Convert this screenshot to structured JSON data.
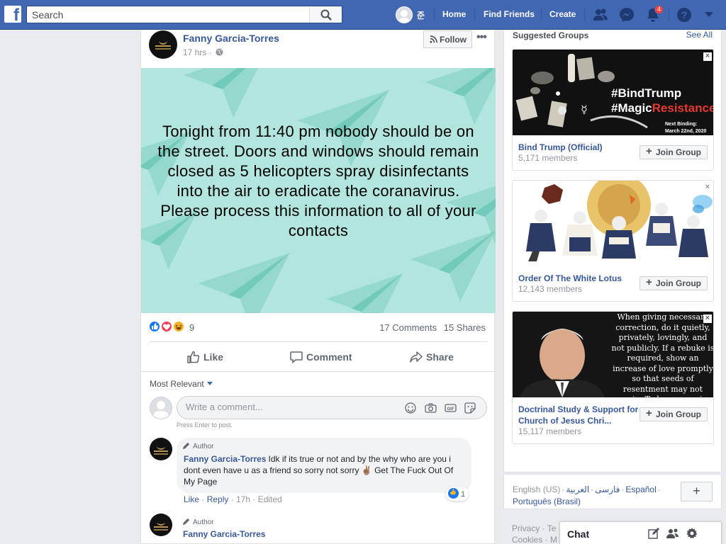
{
  "header": {
    "search_placeholder": "Search",
    "user_name": "준",
    "nav": [
      "Home",
      "Find Friends",
      "Create"
    ],
    "notifications_count": "4"
  },
  "post": {
    "author": "Fanny Garcia-Torres",
    "time": "17 hrs ·",
    "follow_label": "Follow",
    "more": "•••",
    "text": "Tonight from 11:40 pm nobody should be on the street. Doors and windows should remain closed as 5 helicopters spray disinfectants into the air to eradicate the coranavirus. Please process this information to all of your contacts",
    "background_color": "#b1e5dd",
    "reaction_count": "9",
    "comments_count": "17 Comments",
    "shares_count": "15 Shares",
    "actions": {
      "like": "Like",
      "comment": "Comment",
      "share": "Share"
    },
    "sort_label": "Most Relevant",
    "comment_placeholder": "Write a comment...",
    "press_enter": "Press Enter to post."
  },
  "comments": [
    {
      "tag": "Author",
      "name": "Fanny Garcia-Torres",
      "text": "Idk if its true or not and by the why who are you i dont even have u as a friend so sorry not sorry ✌🏽 Get The Fuck Out Of My Page",
      "likes": "1",
      "like_label": "Like",
      "reply_label": "Reply",
      "meta": "· 17h · Edited"
    },
    {
      "tag": "Author",
      "name": "Fanny Garcia-Torres"
    }
  ],
  "sidebar": {
    "title": "Suggested Groups",
    "see_all": "See All",
    "join_label": "Join Group",
    "groups": [
      {
        "name": "Bind Trump (Official)",
        "members": "5,171 members",
        "image_line1": "#BindTrump",
        "image_line2": "#MagicResistance",
        "image_note1": "Next Binding:",
        "image_note2": "March 22nd, 2020"
      },
      {
        "name": "Order Of The White Lotus",
        "members": "12,143 members"
      },
      {
        "name": "Doctrinal Study & Support for Church of Jesus Chri...",
        "members": "15,117 members",
        "image_quote": "When giving necessary correction, do it quietly, privately, lovingly, and not publicly. If a rebuke is required, show an increase of love promptly so that seeds of resentment may not remain. To be persuasive, YOUR LOVE MUST BE SINCERE AND YOUR"
      }
    ]
  },
  "languages": {
    "current": "English (US)",
    "others": [
      "فارسی",
      "العربية",
      "Español",
      "Português (Brasil)"
    ],
    "add": "+"
  },
  "footer": [
    "Privacy · Te",
    "Cookies · M"
  ],
  "chat": {
    "label": "Chat"
  }
}
